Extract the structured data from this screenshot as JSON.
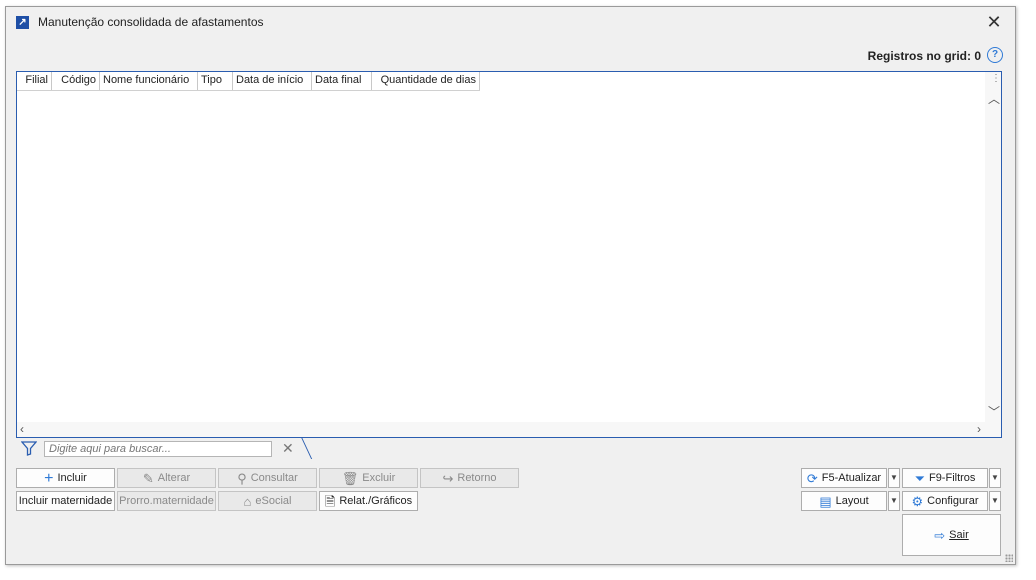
{
  "window": {
    "title": "Manutenção consolidada de afastamentos",
    "close_label": "✕",
    "app_icon": "arrow-icon"
  },
  "header": {
    "registros_label": "Registros no grid: 0",
    "help_label": "?"
  },
  "grid": {
    "columns": [
      "Filial",
      "Código",
      "Nome funcionário",
      "Tipo",
      "Data de início",
      "Data final",
      "Quantidade de dias"
    ],
    "rows": []
  },
  "search": {
    "placeholder": "Digite aqui para buscar...",
    "clear_label": "✕"
  },
  "actions": {
    "incluir": "Incluir",
    "alterar": "Alterar",
    "consultar": "Consultar",
    "excluir": "Excluir",
    "retorno": "Retorno",
    "incluir_maternidade": "Incluir maternidade",
    "prorro_maternidade": "Prorro.maternidade",
    "esocial": "eSocial",
    "relat": "Relat./Gráficos",
    "atualizar": "F5-Atualizar",
    "filtros": "F9-Filtros",
    "layout": "Layout",
    "configurar": "Configurar",
    "sair": "Sair"
  },
  "colors": {
    "accent": "#2a5db0",
    "icon_blue": "#2f7ad6",
    "disabled_bg": "#e9e9e9"
  }
}
